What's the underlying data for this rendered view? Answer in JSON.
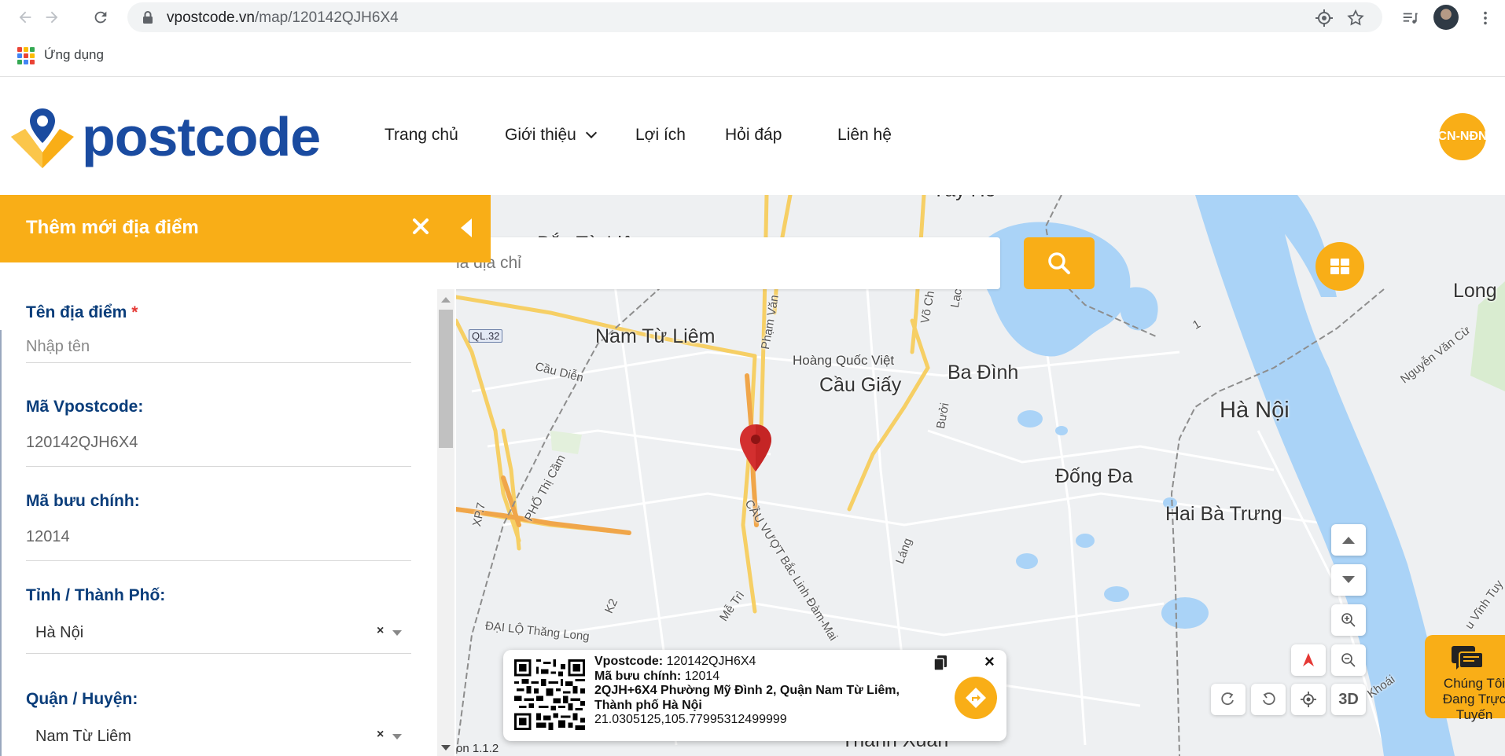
{
  "browser": {
    "url_host": "vpostcode.vn",
    "url_path": "/map/120142QJH6X4",
    "bookmark_apps_label": "Ứng dụng",
    "icons": [
      "back-arrow-icon",
      "forward-arrow-icon",
      "reload-icon",
      "lock-icon",
      "location-target-icon",
      "star-icon",
      "media-queue-icon",
      "profile-avatar",
      "kebab-menu-icon",
      "apps-grid-icon"
    ]
  },
  "site": {
    "logo_text": "postcode",
    "nav": [
      {
        "label": "Trang chủ"
      },
      {
        "label": "Giới thiệu",
        "has_dropdown": true
      },
      {
        "label": "Lợi ích"
      },
      {
        "label": "Hỏi đáp"
      },
      {
        "label": "Liên hệ"
      }
    ],
    "user_badge": "CN-NĐN",
    "accent_color": "#f9ae17",
    "brand_color": "#1a4ba0"
  },
  "panel": {
    "title": "Thêm mới địa điểm",
    "fields": {
      "name": {
        "label": "Tên địa điểm",
        "required_mark": "*",
        "placeholder": "Nhập tên"
      },
      "vpostcode": {
        "label": "Mã Vpostcode:",
        "value": "120142QJH6X4"
      },
      "postal": {
        "label": "Mã bưu chính:",
        "value": "12014"
      },
      "province": {
        "label": "Tỉnh / Thành Phố:",
        "value": "Hà Nội",
        "clear": "×"
      },
      "district": {
        "label": "Quận / Huyện:",
        "value": "Nam Từ Liêm",
        "clear": "×"
      }
    }
  },
  "map": {
    "search_placeholder": "ìm mã địa chỉ",
    "labels": {
      "tay_ho": "Tây Hồ",
      "bac_tu_liem": "Bắc Từ Liêm",
      "nam_tu_liem": "Nam Từ Liêm",
      "cau_giay": "Cầu Giấy",
      "ba_dinh": "Ba Đình",
      "ha_noi": "Hà Nội",
      "dong_da": "Đống Đa",
      "hai_ba_trung": "Hai Bà Trưng",
      "long": "Long",
      "hoang_quoc_viet": "Hoàng Quốc Việt",
      "cau_dien": "Cầu Diễn",
      "pham_van": "Phạm Văn",
      "vo_chi": "Võ Ch",
      "lac": "Lạc",
      "buoi": "Bưởi",
      "lang": "Láng",
      "xp7": "XP.7",
      "pho_thi_cam": "PHỐ Thị Cầm",
      "k2": "K2",
      "me_tri": "Mễ Trì",
      "dai_lo_thang_long": "ĐẠI LỘ Thăng Long",
      "cau_vuot": "CẦU VƯỢT Bắc Linh Đàm-Mai",
      "nguyen_van_cu": "Nguyễn Văn Cừ",
      "u_vinh_tuy": "u Vĩnh Tuy",
      "khoai": "Khoái",
      "thanh_xuan": "Thanh Xuân",
      "road_1": "1",
      "route_ql32": "QL.32"
    },
    "controls": {
      "three_d": "3D"
    },
    "version": "on 1.1.2",
    "chat": {
      "line1": "Chúng Tôi",
      "line2": "Đang Trực",
      "line3": "Tuyến"
    }
  },
  "info_card": {
    "vpostcode_key": "Vpostcode:",
    "vpostcode_val": "120142QJH6X4",
    "postal_key": "Mã bưu chính:",
    "postal_val": "12014",
    "address_line1": "2QJH+6X4 Phường Mỹ Đình 2, Quận Nam Từ Liêm,",
    "address_line2": "Thành phố Hà Nội",
    "coords": "21.0305125,105.77995312499999",
    "close": "×"
  }
}
